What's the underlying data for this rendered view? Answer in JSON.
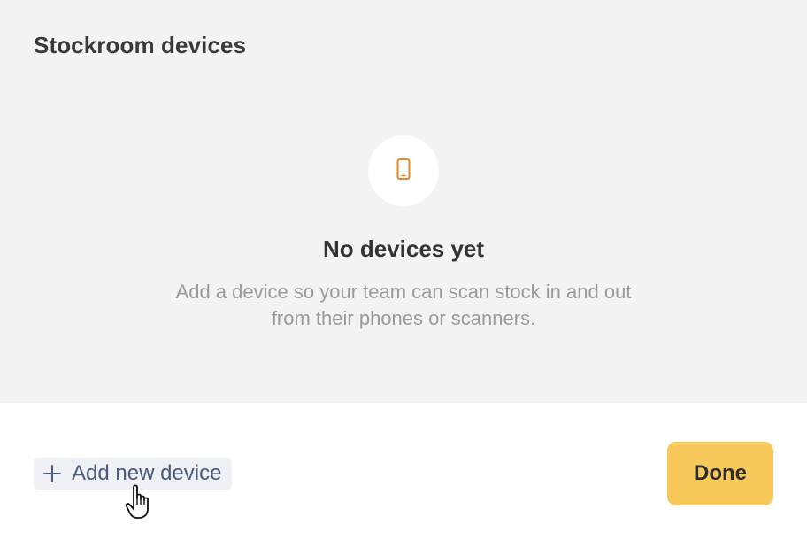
{
  "dialog": {
    "title": "Stockroom devices"
  },
  "empty_state": {
    "icon": "smartphone-icon",
    "icon_color": "#e8872a",
    "title": "No devices yet",
    "description": "Add a device so your team can scan stock in and out from their phones or scanners."
  },
  "footer": {
    "add_icon": "plus-icon",
    "add_label": "Add new device",
    "done_label": "Done",
    "done_color": "#f7c85a",
    "cursor_icon": "pointer-hand-cursor"
  }
}
